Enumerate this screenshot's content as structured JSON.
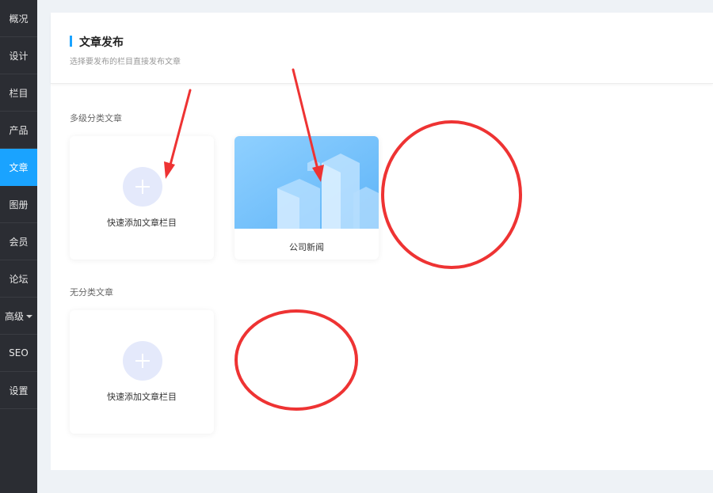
{
  "sidebar": {
    "items": [
      {
        "label": "概况"
      },
      {
        "label": "设计"
      },
      {
        "label": "栏目"
      },
      {
        "label": "产品"
      },
      {
        "label": "文章"
      },
      {
        "label": "图册"
      },
      {
        "label": "会员"
      },
      {
        "label": "论坛"
      },
      {
        "label": "高级"
      },
      {
        "label": "SEO"
      },
      {
        "label": "设置"
      }
    ],
    "active_index": 4
  },
  "header": {
    "title": "文章发布",
    "subtitle": "选择要发布的栏目直接发布文章"
  },
  "sections": [
    {
      "label": "多级分类文章",
      "add_card_label": "快速添加文章栏目",
      "columns": [
        {
          "label": "公司新闻"
        }
      ]
    },
    {
      "label": "无分类文章",
      "add_card_label": "快速添加文章栏目"
    }
  ],
  "colors": {
    "accent": "#1aa3ff",
    "sidebar_bg": "#2b2d33",
    "annotation": "#ee3333"
  },
  "icons": {
    "add": "plus-icon",
    "caret": "caret-down-icon"
  }
}
